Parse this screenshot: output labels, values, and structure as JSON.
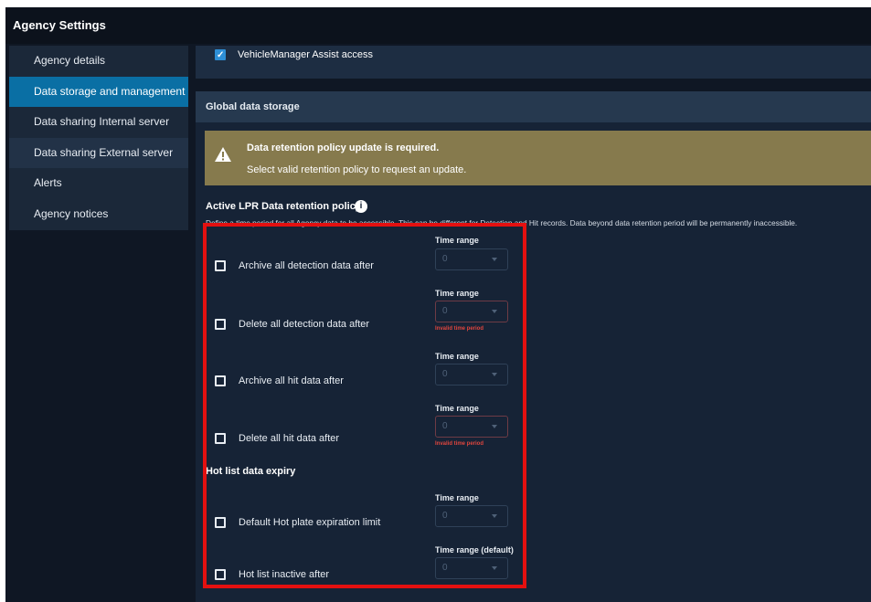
{
  "window": {
    "title": "Agency Settings"
  },
  "sidebar": {
    "items": [
      {
        "label": "Agency details"
      },
      {
        "label": "Data storage and management"
      },
      {
        "label": "Data sharing Internal server"
      },
      {
        "label": "Data sharing External server"
      },
      {
        "label": "Alerts"
      },
      {
        "label": "Agency notices"
      }
    ]
  },
  "top_card": {
    "vehiclemanager_label": "VehicleManager Assist access",
    "checked": true
  },
  "global": {
    "header": "Global data storage",
    "warning": {
      "title": "Data retention policy update is required.",
      "text": "Select valid retention policy to request an update."
    },
    "policy_title": "Active LPR Data retention policy",
    "policy_desc": "Define a time period for all Agency data to be accessible. This can be different for Detection and Hit records. Data beyond data retention period will be permanently inaccessible.",
    "rows": [
      {
        "label": "Archive all detection data after",
        "range_label": "Time range",
        "value": "0",
        "error": ""
      },
      {
        "label": "Delete all detection data after",
        "range_label": "Time range",
        "value": "0",
        "error": "Invalid time period"
      },
      {
        "label": "Archive all hit data after",
        "range_label": "Time range",
        "value": "0",
        "error": ""
      },
      {
        "label": "Delete all hit data after",
        "range_label": "Time range",
        "value": "0",
        "error": "Invalid time period"
      }
    ],
    "hot_title": "Hot list data expiry",
    "hot_rows": [
      {
        "label": "Default Hot plate expiration limit",
        "range_label": "Time range",
        "value": "0"
      },
      {
        "label": "Hot list inactive after",
        "range_label": "Time range (default)",
        "value": "0"
      }
    ]
  },
  "colors": {
    "active_sidebar": "#0a6fa4",
    "warning_bg": "#867a4d",
    "error_text": "#e0463e",
    "highlight_border": "#e41010"
  }
}
